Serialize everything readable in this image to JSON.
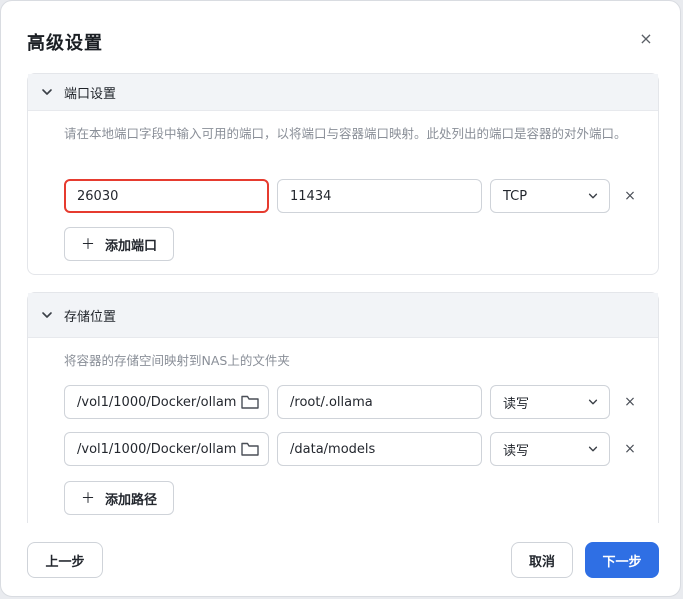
{
  "dialog": {
    "title": "高级设置",
    "close_icon": "×"
  },
  "ports": {
    "section_title": "端口设置",
    "description": "请在本地端口字段中输入可用的端口，以将端口与容器端口映射。此处列出的端口是容器的对外端口。",
    "rows": [
      {
        "local_port": "26030",
        "container_port": "11434",
        "protocol": "TCP"
      }
    ],
    "add_label": "添加端口"
  },
  "storage": {
    "section_title": "存储位置",
    "description": "将容器的存储空间映射到NAS上的文件夹",
    "rows": [
      {
        "host_path": "/vol1/1000/Docker/ollam",
        "container_path": "/root/.ollama",
        "mode": "读写"
      },
      {
        "host_path": "/vol1/1000/Docker/ollam",
        "container_path": "/data/models",
        "mode": "读写"
      }
    ],
    "add_label": "添加路径"
  },
  "footer": {
    "prev_label": "上一步",
    "cancel_label": "取消",
    "next_label": "下一步"
  },
  "colors": {
    "primary": "#2f6fe4",
    "highlight": "#e63b2f"
  }
}
